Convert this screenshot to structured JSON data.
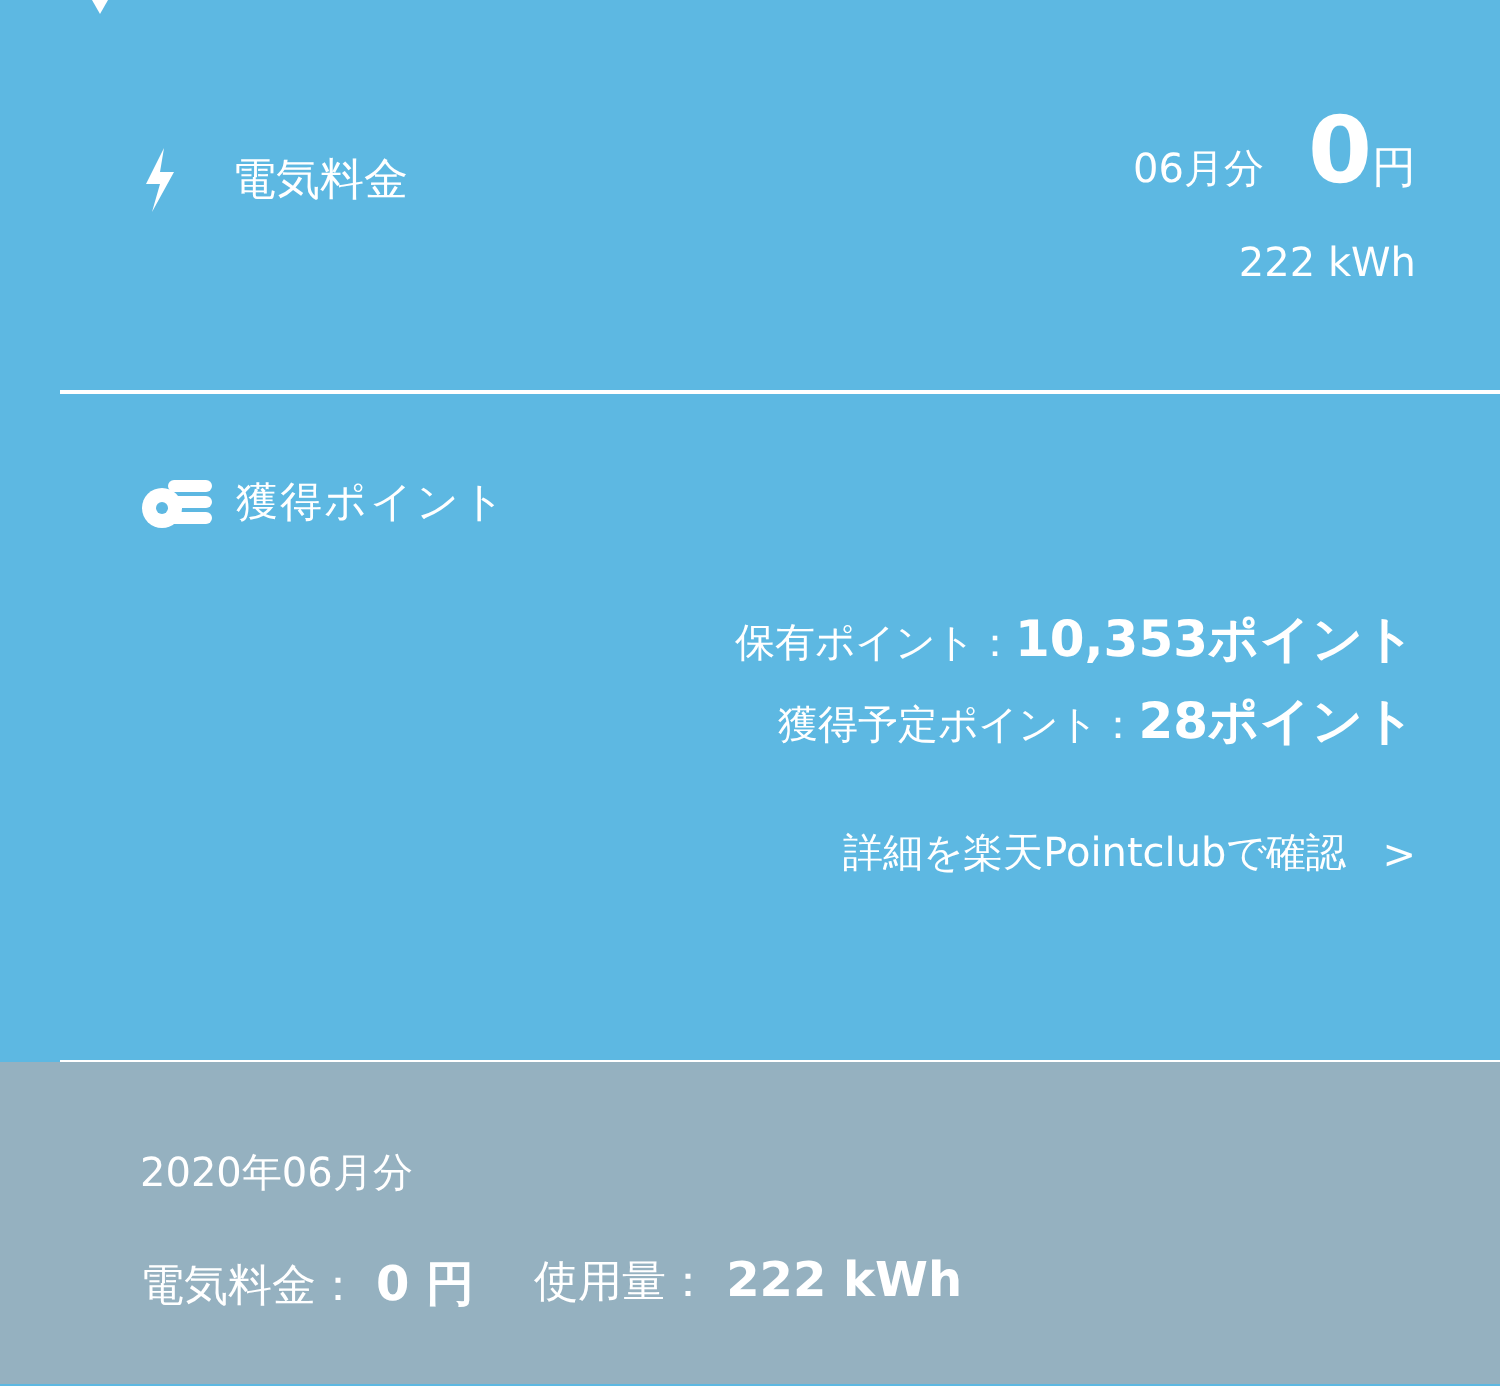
{
  "electricity": {
    "title": "電気料金",
    "month": "06月分",
    "amount": "0",
    "unit": "円",
    "usage": "222 kWh"
  },
  "points": {
    "title": "獲得ポイント",
    "rows": [
      {
        "label": "保有ポイント：",
        "value": "10,353ポイント"
      },
      {
        "label": "獲得予定ポイント：",
        "value": "28ポイント"
      }
    ],
    "link": {
      "label": "詳細を楽天Pointclubで確認",
      "arrow": ">"
    }
  },
  "history": {
    "period": "2020年06月分",
    "items": [
      {
        "label": "電気料金：",
        "value": "0 円"
      },
      {
        "label": "使用量：",
        "value": "222 kWh"
      }
    ]
  }
}
